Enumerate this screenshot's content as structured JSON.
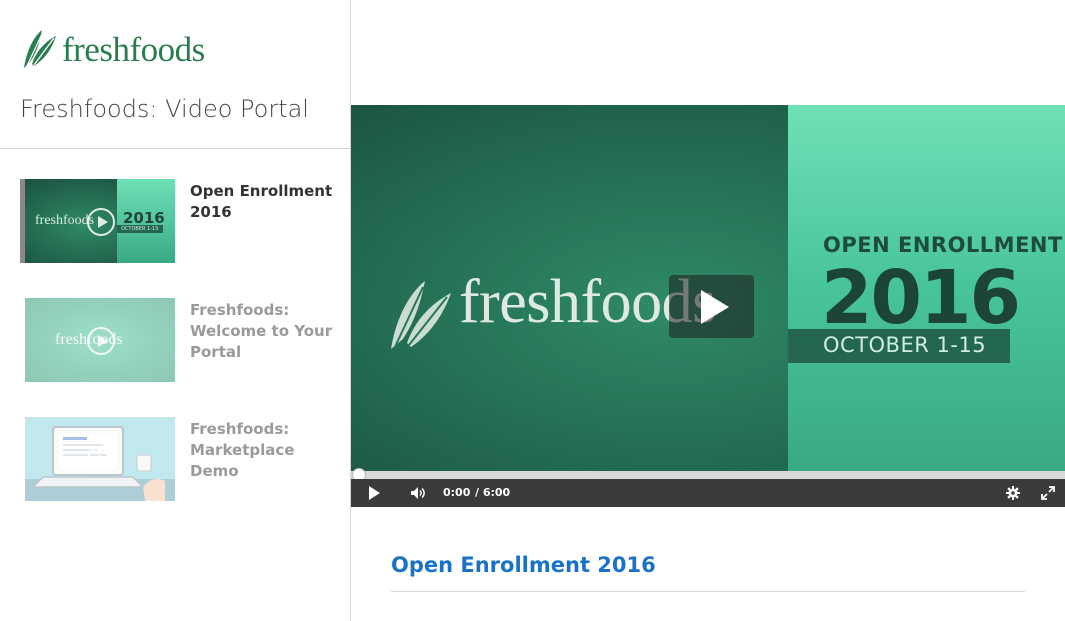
{
  "brand": {
    "name": "freshfoods",
    "color": "#2a7d4f"
  },
  "portal": {
    "title": "Freshfoods: Video Portal"
  },
  "playlist": [
    {
      "label": "Open Enrollment 2016",
      "active": true,
      "thumb_text": "freshfoods",
      "thumb_badge_year": "2016",
      "thumb_badge_date": "OCTOBER 1-15"
    },
    {
      "label": "Freshfoods: Welcome to Your Portal",
      "active": false,
      "thumb_text": "freshfoods"
    },
    {
      "label": "Freshfoods: Marketplace Demo",
      "active": false
    }
  ],
  "player": {
    "frame": {
      "logo_text": "freshfoods",
      "headline": "OPEN ENROLLMENT",
      "year": "2016",
      "dates": "OCTOBER 1-15"
    },
    "current_time": "0:00",
    "duration": "/ 6:00",
    "progress_fraction": 0.0,
    "icons": [
      "play-icon",
      "volume-icon",
      "settings-gear-icon",
      "fullscreen-icon"
    ]
  },
  "video": {
    "title": "Open Enrollment 2016",
    "title_color": "#1a73c8"
  }
}
